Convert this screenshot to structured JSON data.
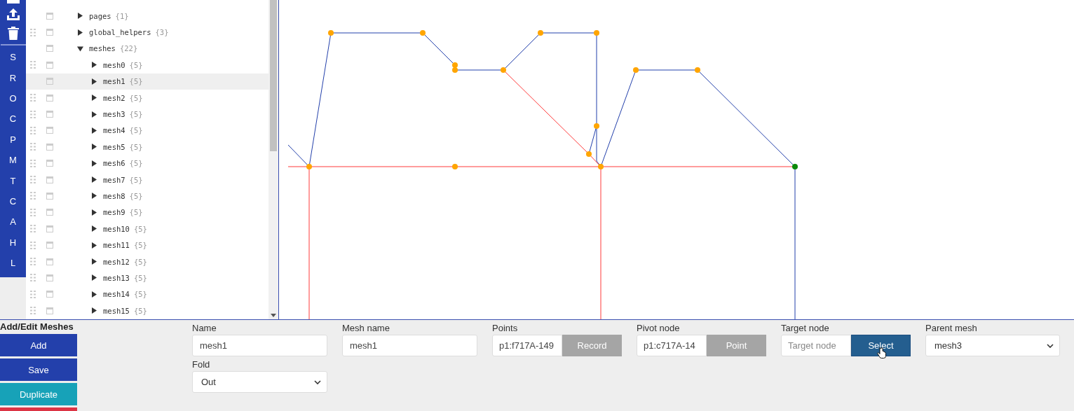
{
  "sidebar": {
    "letters": [
      "S",
      "R",
      "O",
      "C",
      "P",
      "M",
      "T",
      "C",
      "A",
      "H",
      "L"
    ]
  },
  "tree": [
    {
      "name": "pages",
      "count": "{1}",
      "expanded": false,
      "draggable": false,
      "selected": false
    },
    {
      "name": "global_helpers",
      "count": "{3}",
      "expanded": false,
      "draggable": true,
      "selected": false
    },
    {
      "name": "meshes",
      "count": "{22}",
      "expanded": true,
      "draggable": false,
      "selected": false,
      "children": [
        {
          "name": "mesh0",
          "count": "{5}",
          "expanded": false,
          "draggable": true,
          "selected": false
        },
        {
          "name": "mesh1",
          "count": "{5}",
          "expanded": false,
          "draggable": false,
          "selected": true
        },
        {
          "name": "mesh2",
          "count": "{5}",
          "expanded": false,
          "draggable": true,
          "selected": false
        },
        {
          "name": "mesh3",
          "count": "{5}",
          "expanded": false,
          "draggable": true,
          "selected": false
        },
        {
          "name": "mesh4",
          "count": "{5}",
          "expanded": false,
          "draggable": true,
          "selected": false
        },
        {
          "name": "mesh5",
          "count": "{5}",
          "expanded": false,
          "draggable": true,
          "selected": false
        },
        {
          "name": "mesh6",
          "count": "{5}",
          "expanded": false,
          "draggable": true,
          "selected": false
        },
        {
          "name": "mesh7",
          "count": "{5}",
          "expanded": false,
          "draggable": true,
          "selected": false
        },
        {
          "name": "mesh8",
          "count": "{5}",
          "expanded": false,
          "draggable": true,
          "selected": false
        },
        {
          "name": "mesh9",
          "count": "{5}",
          "expanded": false,
          "draggable": true,
          "selected": false
        },
        {
          "name": "mesh10",
          "count": "{5}",
          "expanded": false,
          "draggable": true,
          "selected": false
        },
        {
          "name": "mesh11",
          "count": "{5}",
          "expanded": false,
          "draggable": true,
          "selected": false
        },
        {
          "name": "mesh12",
          "count": "{5}",
          "expanded": false,
          "draggable": true,
          "selected": false
        },
        {
          "name": "mesh13",
          "count": "{5}",
          "expanded": false,
          "draggable": true,
          "selected": false
        },
        {
          "name": "mesh14",
          "count": "{5}",
          "expanded": false,
          "draggable": true,
          "selected": false
        },
        {
          "name": "mesh15",
          "count": "{5}",
          "expanded": false,
          "draggable": true,
          "selected": false
        }
      ]
    }
  ],
  "editor": {
    "title": "Add/Edit Meshes",
    "buttons": [
      {
        "label": "Add",
        "kind": "primary"
      },
      {
        "label": "Save",
        "kind": "primary"
      },
      {
        "label": "Duplicate",
        "kind": "info"
      },
      {
        "kind": "danger"
      }
    ],
    "fields": [
      {
        "label": "Name",
        "kind": "text",
        "value": "mesh1"
      },
      {
        "label": "Mesh name",
        "kind": "text",
        "value": "mesh1"
      },
      {
        "label": "Points",
        "kind": "picker",
        "value": "p1:f717A-149",
        "button": "Record",
        "active": false
      },
      {
        "label": "Pivot node",
        "kind": "picker",
        "value": "p1:c717A-14",
        "button": "Point",
        "active": false
      },
      {
        "label": "Target node",
        "kind": "picker",
        "placeholder": "Target node",
        "button": "Select",
        "active": true
      },
      {
        "label": "Parent mesh",
        "kind": "select",
        "value": "mesh3"
      },
      {
        "label": "Fold",
        "kind": "select",
        "value": "Out"
      }
    ]
  }
}
